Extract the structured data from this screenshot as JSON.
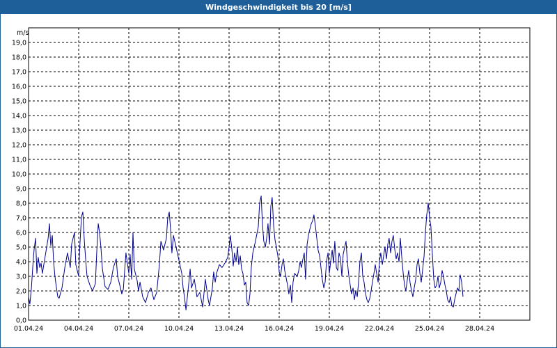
{
  "window": {
    "title": "Windgeschwindigkeit bis 20 [m/s]"
  },
  "chart_data": {
    "type": "line",
    "title": "Windgeschwindigkeit bis 20 [m/s]",
    "ylabel": "m/s",
    "ylim": [
      0,
      20
    ],
    "xlim_days": [
      0,
      30
    ],
    "grid": true,
    "y_ticks": [
      "0,0",
      "1,0",
      "2,0",
      "3,0",
      "4,0",
      "5,0",
      "6,0",
      "7,0",
      "8,0",
      "9,0",
      "10,0",
      "11,0",
      "12,0",
      "13,0",
      "14,0",
      "15,0",
      "16,0",
      "17,0",
      "18,0",
      "19,0"
    ],
    "x_ticks": [
      {
        "label": "01.04.24",
        "day": 0
      },
      {
        "label": "04.04.24",
        "day": 3
      },
      {
        "label": "07.04.24",
        "day": 6
      },
      {
        "label": "10.04.24",
        "day": 9
      },
      {
        "label": "13.04.24",
        "day": 12
      },
      {
        "label": "16.04.24",
        "day": 15
      },
      {
        "label": "19.04.24",
        "day": 18
      },
      {
        "label": "22.04.24",
        "day": 21
      },
      {
        "label": "25.04.24",
        "day": 24
      },
      {
        "label": "28.04.24",
        "day": 27
      }
    ],
    "series": [
      {
        "color": "#00008b",
        "points": [
          [
            0.0,
            1.6
          ],
          [
            0.08,
            1.1
          ],
          [
            0.17,
            2.2
          ],
          [
            0.25,
            3.6
          ],
          [
            0.33,
            4.8
          ],
          [
            0.42,
            5.6
          ],
          [
            0.5,
            3.2
          ],
          [
            0.58,
            4.3
          ],
          [
            0.67,
            3.6
          ],
          [
            0.75,
            3.9
          ],
          [
            0.83,
            3.2
          ],
          [
            1.0,
            4.4
          ],
          [
            1.17,
            5.6
          ],
          [
            1.25,
            6.6
          ],
          [
            1.33,
            5.1
          ],
          [
            1.42,
            5.8
          ],
          [
            1.5,
            4.0
          ],
          [
            1.58,
            3.0
          ],
          [
            1.67,
            2.2
          ],
          [
            1.75,
            1.6
          ],
          [
            1.83,
            1.5
          ],
          [
            2.0,
            2.2
          ],
          [
            2.17,
            3.6
          ],
          [
            2.33,
            4.6
          ],
          [
            2.5,
            3.6
          ],
          [
            2.58,
            5.2
          ],
          [
            2.75,
            6.0
          ],
          [
            2.83,
            3.8
          ],
          [
            3.0,
            3.0
          ],
          [
            3.08,
            5.3
          ],
          [
            3.17,
            7.1
          ],
          [
            3.25,
            7.4
          ],
          [
            3.33,
            5.6
          ],
          [
            3.42,
            4.1
          ],
          [
            3.5,
            3.0
          ],
          [
            3.67,
            2.4
          ],
          [
            3.83,
            2.0
          ],
          [
            4.0,
            2.5
          ],
          [
            4.08,
            4.6
          ],
          [
            4.17,
            6.6
          ],
          [
            4.25,
            6.0
          ],
          [
            4.33,
            5.0
          ],
          [
            4.42,
            3.5
          ],
          [
            4.58,
            2.3
          ],
          [
            4.75,
            2.1
          ],
          [
            4.92,
            2.6
          ],
          [
            5.08,
            3.6
          ],
          [
            5.25,
            4.2
          ],
          [
            5.33,
            3.0
          ],
          [
            5.5,
            2.2
          ],
          [
            5.58,
            1.8
          ],
          [
            5.67,
            2.1
          ],
          [
            5.83,
            4.6
          ],
          [
            6.0,
            3.2
          ],
          [
            6.08,
            4.5
          ],
          [
            6.17,
            2.8
          ],
          [
            6.25,
            6.0
          ],
          [
            6.33,
            3.5
          ],
          [
            6.5,
            2.7
          ],
          [
            6.58,
            2.0
          ],
          [
            6.67,
            2.6
          ],
          [
            6.83,
            1.6
          ],
          [
            7.0,
            1.2
          ],
          [
            7.17,
            1.9
          ],
          [
            7.33,
            2.2
          ],
          [
            7.5,
            1.4
          ],
          [
            7.67,
            1.9
          ],
          [
            7.83,
            3.8
          ],
          [
            7.92,
            5.4
          ],
          [
            8.08,
            4.8
          ],
          [
            8.25,
            5.6
          ],
          [
            8.33,
            7.0
          ],
          [
            8.42,
            7.4
          ],
          [
            8.5,
            6.2
          ],
          [
            8.58,
            4.6
          ],
          [
            8.67,
            5.8
          ],
          [
            8.83,
            5.0
          ],
          [
            9.0,
            4.1
          ],
          [
            9.17,
            3.2
          ],
          [
            9.25,
            2.2
          ],
          [
            9.33,
            1.6
          ],
          [
            9.42,
            0.7
          ],
          [
            9.58,
            2.4
          ],
          [
            9.67,
            3.5
          ],
          [
            9.75,
            2.2
          ],
          [
            9.92,
            2.8
          ],
          [
            10.08,
            1.6
          ],
          [
            10.25,
            1.9
          ],
          [
            10.42,
            0.9
          ],
          [
            10.58,
            2.8
          ],
          [
            10.75,
            1.4
          ],
          [
            10.83,
            1.0
          ],
          [
            11.0,
            2.2
          ],
          [
            11.08,
            3.3
          ],
          [
            11.17,
            2.6
          ],
          [
            11.25,
            3.2
          ],
          [
            11.42,
            3.8
          ],
          [
            11.58,
            3.6
          ],
          [
            11.75,
            3.9
          ],
          [
            11.92,
            4.3
          ],
          [
            12.0,
            5.0
          ],
          [
            12.08,
            5.8
          ],
          [
            12.17,
            4.8
          ],
          [
            12.25,
            3.7
          ],
          [
            12.33,
            4.6
          ],
          [
            12.42,
            4.0
          ],
          [
            12.5,
            5.0
          ],
          [
            12.58,
            3.8
          ],
          [
            12.67,
            4.4
          ],
          [
            12.75,
            3.5
          ],
          [
            12.83,
            3.2
          ],
          [
            12.92,
            2.4
          ],
          [
            13.0,
            2.6
          ],
          [
            13.08,
            1.2
          ],
          [
            13.17,
            1.0
          ],
          [
            13.25,
            1.8
          ],
          [
            13.33,
            3.6
          ],
          [
            13.42,
            4.6
          ],
          [
            13.58,
            5.4
          ],
          [
            13.75,
            6.4
          ],
          [
            13.83,
            8.0
          ],
          [
            13.92,
            8.5
          ],
          [
            14.0,
            6.5
          ],
          [
            14.08,
            5.4
          ],
          [
            14.17,
            5.0
          ],
          [
            14.25,
            5.6
          ],
          [
            14.33,
            6.6
          ],
          [
            14.42,
            5.2
          ],
          [
            14.5,
            7.8
          ],
          [
            14.58,
            8.4
          ],
          [
            14.67,
            6.4
          ],
          [
            14.75,
            5.5
          ],
          [
            14.83,
            5.0
          ],
          [
            14.92,
            4.4
          ],
          [
            15.0,
            3.3
          ],
          [
            15.08,
            3.0
          ],
          [
            15.17,
            3.8
          ],
          [
            15.25,
            4.2
          ],
          [
            15.33,
            3.4
          ],
          [
            15.5,
            2.4
          ],
          [
            15.58,
            1.8
          ],
          [
            15.67,
            2.4
          ],
          [
            15.75,
            1.2
          ],
          [
            15.83,
            2.6
          ],
          [
            15.92,
            3.2
          ],
          [
            16.08,
            3.0
          ],
          [
            16.17,
            3.4
          ],
          [
            16.25,
            4.0
          ],
          [
            16.33,
            3.6
          ],
          [
            16.42,
            4.2
          ],
          [
            16.5,
            4.6
          ],
          [
            16.58,
            2.8
          ],
          [
            16.67,
            5.2
          ],
          [
            16.75,
            5.8
          ],
          [
            16.83,
            6.2
          ],
          [
            16.92,
            6.6
          ],
          [
            17.0,
            6.8
          ],
          [
            17.08,
            7.2
          ],
          [
            17.17,
            6.4
          ],
          [
            17.25,
            5.6
          ],
          [
            17.33,
            4.8
          ],
          [
            17.42,
            4.4
          ],
          [
            17.5,
            3.6
          ],
          [
            17.58,
            2.8
          ],
          [
            17.67,
            2.2
          ],
          [
            17.75,
            2.6
          ],
          [
            17.83,
            4.0
          ],
          [
            17.92,
            4.6
          ],
          [
            18.0,
            3.2
          ],
          [
            18.08,
            4.0
          ],
          [
            18.17,
            4.8
          ],
          [
            18.25,
            3.9
          ],
          [
            18.33,
            5.4
          ],
          [
            18.42,
            3.6
          ],
          [
            18.5,
            3.4
          ],
          [
            18.58,
            4.6
          ],
          [
            18.67,
            4.2
          ],
          [
            18.75,
            3.0
          ],
          [
            18.83,
            4.5
          ],
          [
            18.92,
            5.0
          ],
          [
            19.0,
            5.4
          ],
          [
            19.08,
            4.0
          ],
          [
            19.17,
            3.0
          ],
          [
            19.25,
            2.4
          ],
          [
            19.33,
            1.8
          ],
          [
            19.42,
            2.2
          ],
          [
            19.5,
            1.4
          ],
          [
            19.58,
            2.0
          ],
          [
            19.67,
            1.6
          ],
          [
            19.75,
            2.6
          ],
          [
            19.83,
            4.0
          ],
          [
            19.92,
            4.6
          ],
          [
            20.0,
            3.0
          ],
          [
            20.08,
            2.6
          ],
          [
            20.17,
            1.8
          ],
          [
            20.25,
            1.4
          ],
          [
            20.33,
            1.2
          ],
          [
            20.42,
            1.5
          ],
          [
            20.5,
            2.0
          ],
          [
            20.58,
            2.6
          ],
          [
            20.67,
            3.2
          ],
          [
            20.75,
            3.8
          ],
          [
            20.83,
            3.2
          ],
          [
            20.92,
            2.6
          ],
          [
            21.0,
            4.0
          ],
          [
            21.08,
            4.6
          ],
          [
            21.17,
            3.8
          ],
          [
            21.25,
            4.4
          ],
          [
            21.33,
            5.0
          ],
          [
            21.42,
            4.2
          ],
          [
            21.5,
            5.2
          ],
          [
            21.58,
            5.6
          ],
          [
            21.67,
            4.6
          ],
          [
            21.75,
            5.4
          ],
          [
            21.83,
            5.8
          ],
          [
            21.92,
            4.8
          ],
          [
            22.0,
            4.2
          ],
          [
            22.08,
            4.6
          ],
          [
            22.17,
            4.0
          ],
          [
            22.25,
            5.6
          ],
          [
            22.33,
            4.4
          ],
          [
            22.42,
            3.2
          ],
          [
            22.5,
            2.4
          ],
          [
            22.58,
            2.0
          ],
          [
            22.67,
            2.8
          ],
          [
            22.75,
            3.4
          ],
          [
            22.83,
            2.6
          ],
          [
            22.92,
            2.0
          ],
          [
            23.0,
            1.6
          ],
          [
            23.08,
            2.2
          ],
          [
            23.17,
            2.8
          ],
          [
            23.25,
            3.8
          ],
          [
            23.33,
            4.2
          ],
          [
            23.42,
            3.2
          ],
          [
            23.5,
            2.6
          ],
          [
            23.58,
            3.4
          ],
          [
            23.67,
            4.4
          ],
          [
            23.75,
            6.0
          ],
          [
            23.83,
            7.2
          ],
          [
            23.92,
            8.0
          ],
          [
            24.0,
            7.0
          ],
          [
            24.08,
            6.4
          ],
          [
            24.17,
            4.4
          ],
          [
            24.25,
            2.8
          ],
          [
            24.33,
            2.2
          ],
          [
            24.42,
            2.4
          ],
          [
            24.5,
            3.0
          ],
          [
            24.58,
            2.2
          ],
          [
            24.67,
            2.6
          ],
          [
            24.75,
            3.4
          ],
          [
            24.83,
            3.0
          ],
          [
            24.92,
            2.4
          ],
          [
            25.0,
            2.0
          ],
          [
            25.08,
            1.4
          ],
          [
            25.17,
            1.2
          ],
          [
            25.25,
            1.6
          ],
          [
            25.33,
            1.0
          ],
          [
            25.42,
            0.9
          ],
          [
            25.5,
            1.4
          ],
          [
            25.58,
            1.8
          ],
          [
            25.67,
            2.2
          ],
          [
            25.75,
            2.0
          ],
          [
            25.83,
            3.1
          ],
          [
            25.92,
            2.6
          ],
          [
            26.0,
            1.6
          ]
        ]
      }
    ]
  }
}
